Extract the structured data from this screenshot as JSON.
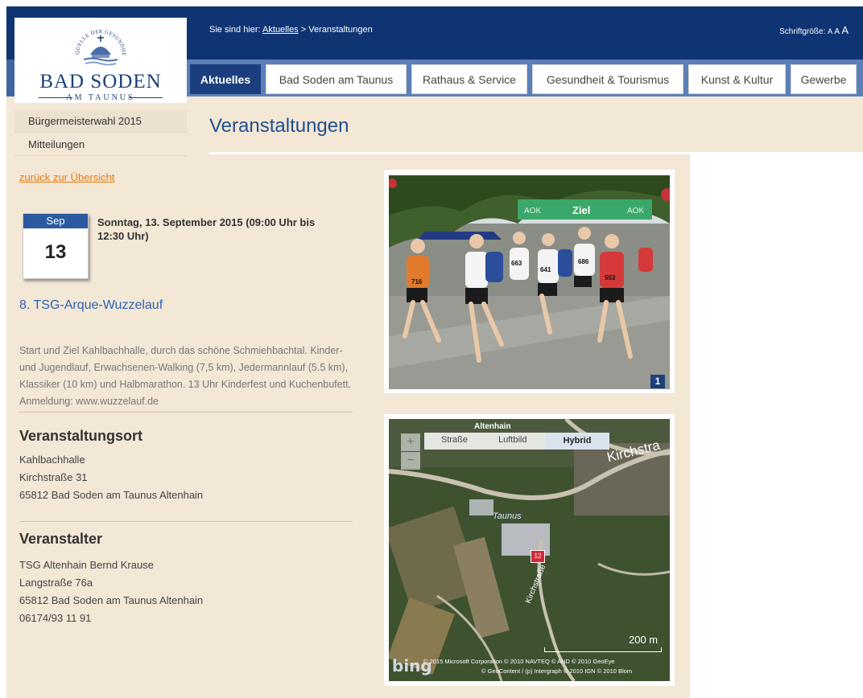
{
  "header": {
    "logo_main": "BAD SODEN",
    "logo_sub": "AM TAUNUS",
    "logo_arc_text": "QUELLE DER GESUNDHEIT",
    "breadcrumb_prefix": "Sie sind hier:",
    "breadcrumb_link": "Aktuelles",
    "breadcrumb_sep": ">",
    "breadcrumb_current": "Veranstaltungen",
    "font_size_label": "Schriftgröße:",
    "font_size_options": [
      "A",
      "A",
      "A"
    ]
  },
  "nav": {
    "tabs": [
      {
        "label": "Aktuelles",
        "active": true
      },
      {
        "label": "Bad Soden am Taunus"
      },
      {
        "label": "Rathaus & Service"
      },
      {
        "label": "Gesundheit & Tourismus"
      },
      {
        "label": "Kunst & Kultur"
      },
      {
        "label": "Gewerbe"
      }
    ]
  },
  "sidebar": {
    "items": [
      {
        "label": "Bürgermeisterwahl 2015"
      },
      {
        "label": "Mitteilungen"
      }
    ]
  },
  "main": {
    "page_title": "Veranstaltungen",
    "back_link": "zurück zur Übersicht",
    "calendar": {
      "month": "Sep",
      "day": "13"
    },
    "event_date": "Sonntag, 13. September 2015 (09:00 Uhr bis 12:30 Uhr)",
    "event_title": "8. TSG-Arque-Wuzzelauf",
    "event_description": "Start und Ziel Kahlbachhalle, durch das schöne Schmiehbachtal. Kinder- und Jugendlauf, Erwachsenen-Walking (7,5 km), Jedermannlauf (5.5 km), Klassiker (10 km) und Halbmarathon. 13 Uhr Kinderfest und Kuchenbufett. Anmeldung: www.wuzzelauf.de",
    "venue": {
      "heading": "Veranstaltungsort",
      "lines": [
        "Kahlbachhalle",
        "Kirchstraße 31",
        "65812 Bad Soden am Taunus Altenhain"
      ]
    },
    "organizer": {
      "heading": "Veranstalter",
      "lines": [
        "TSG Altenhain Bernd Krause",
        "Langstraße 76a",
        "65812 Bad Soden am Taunus Altenhain",
        "06174/93 11 91"
      ]
    }
  },
  "photo": {
    "badge": "1",
    "banner_text": "Ziel",
    "banner_logo": "AOK",
    "bibs": [
      "716",
      "553",
      "686",
      "641",
      "663"
    ]
  },
  "map": {
    "types": [
      "Straße",
      "Luftbild",
      "Hybrid"
    ],
    "active_type": "Hybrid",
    "zoom_in": "+",
    "zoom_out": "−",
    "labels": {
      "top": "Altenhain",
      "road_big": "Kirchstra",
      "area": "Taunus",
      "road_small": "Kirchstraße"
    },
    "pin": "12",
    "scale": "200 m",
    "copyright_1": "© 2015 Microsoft Corporation   © 2010 NAVTEQ   © AND   © 2010 GeoEye",
    "copyright_2": "© GeoContent / (p) Intergraph   © 2010 IGN   © 2010 Blom",
    "brand": "bing"
  },
  "colors": {
    "topbar": "#0f3474",
    "navbar": "#5c7fb8",
    "active_tab": "#1b3f7e",
    "beige": "#f3e7d6",
    "title_blue": "#1f4f8f",
    "link_orange": "#e27b16"
  }
}
